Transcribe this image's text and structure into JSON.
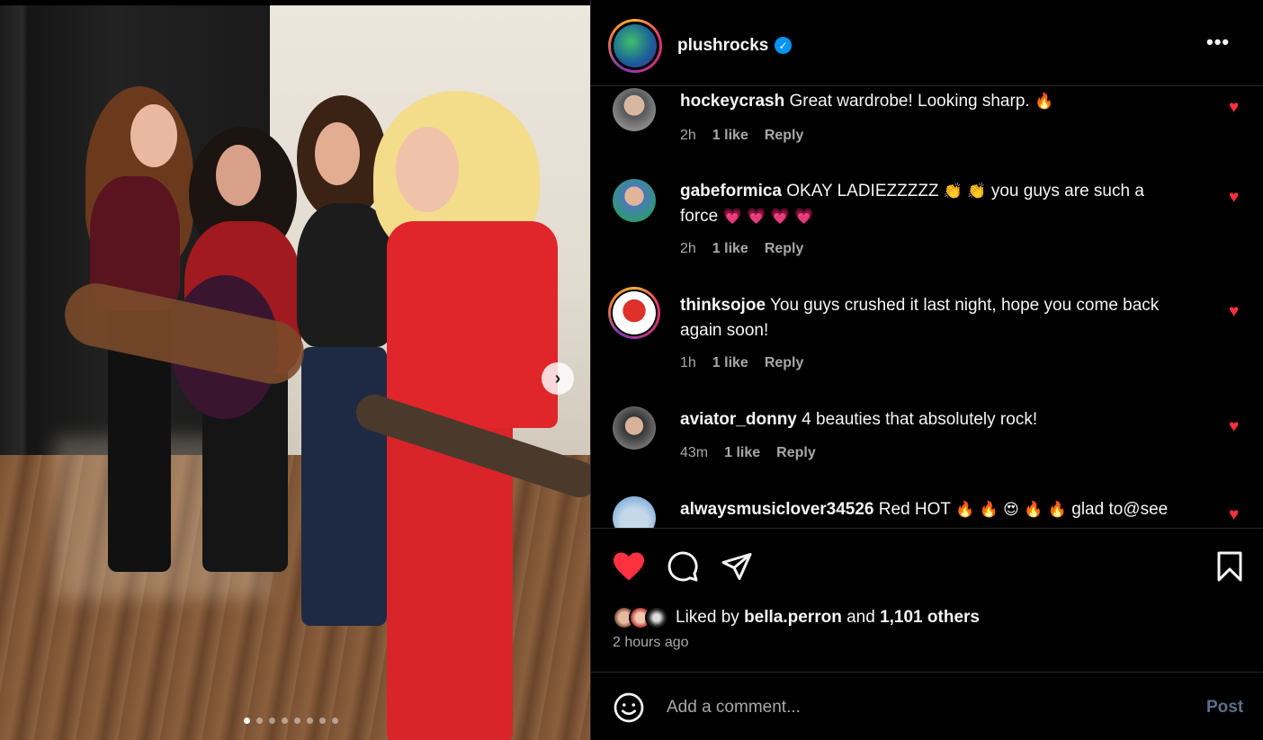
{
  "post": {
    "username": "plushrocks",
    "verified": true,
    "carousel": {
      "dot_count": 8,
      "active_index": 0
    }
  },
  "comments": [
    {
      "username": "hockeycrash",
      "text": "Great wardrobe! Looking sharp.",
      "emoji": "🔥",
      "time": "2h",
      "likes": "1 like",
      "reply": "Reply",
      "liked": true
    },
    {
      "username": "gabeformica",
      "text": "OKAY LADIEZZZZZ",
      "emoji": "👏 👏",
      "text2": "you guys are such a force",
      "emoji2": "💗 💗 💗 💗",
      "time": "2h",
      "likes": "1 like",
      "reply": "Reply",
      "liked": true
    },
    {
      "username": "thinksojoe",
      "text": "You guys crushed it last night, hope you come back again soon!",
      "time": "1h",
      "likes": "1 like",
      "reply": "Reply",
      "liked": true
    },
    {
      "username": "aviator_donny",
      "text": "4 beauties that absolutely rock!",
      "time": "43m",
      "likes": "1 like",
      "reply": "Reply",
      "liked": true
    },
    {
      "username": "alwaysmusiclover34526",
      "text": "Red HOT",
      "emoji": "🔥 🔥 😍 🔥 🔥",
      "text2": "glad to@see",
      "liked": true
    }
  ],
  "actions": {
    "liked_prefix": "Liked by",
    "liked_user": "bella.perron",
    "liked_and": "and",
    "liked_others": "1,101 others",
    "time_ago": "2 hours ago"
  },
  "composer": {
    "placeholder": "Add a comment...",
    "post_label": "Post"
  },
  "colors": {
    "like_red": "#ff3040",
    "muted_text": "#a8a8a8",
    "verified_blue": "#0095f6"
  }
}
